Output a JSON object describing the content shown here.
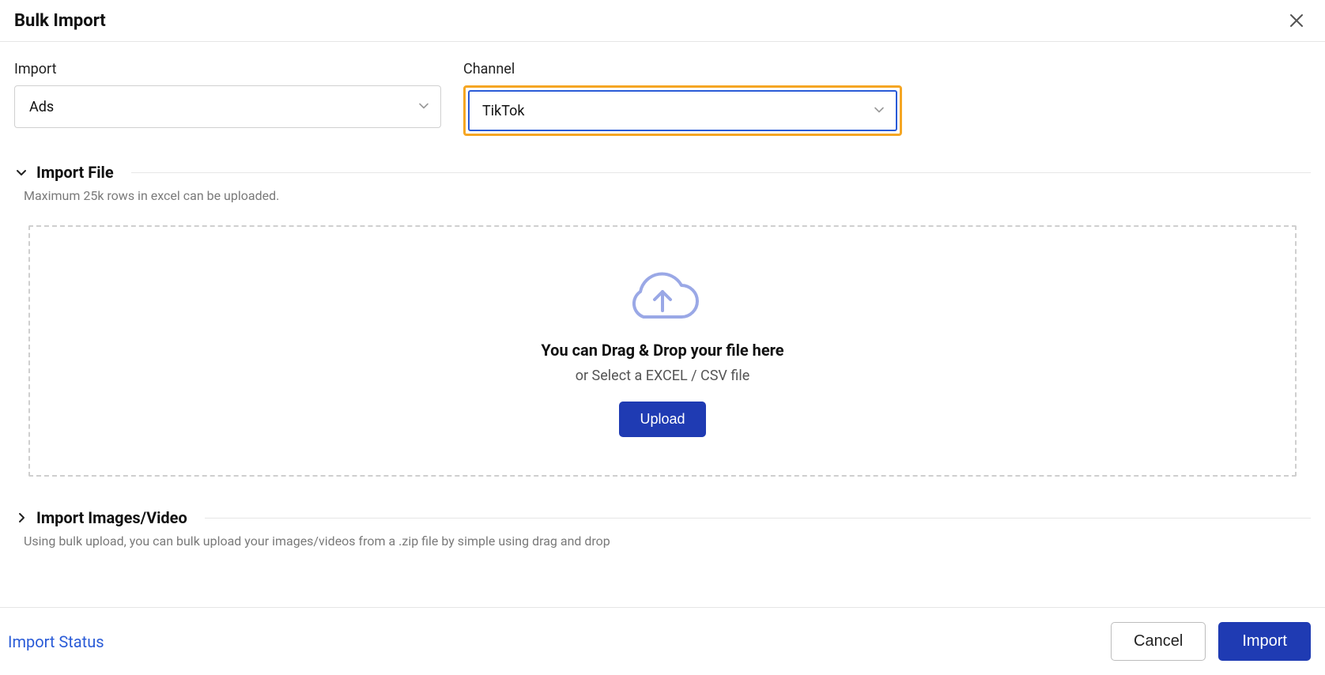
{
  "header": {
    "title": "Bulk Import"
  },
  "fields": {
    "import_label": "Import",
    "import_value": "Ads",
    "channel_label": "Channel",
    "channel_value": "TikTok"
  },
  "import_file": {
    "title": "Import File",
    "subtitle": "Maximum 25k rows in excel can be uploaded.",
    "drop_title": "You can Drag & Drop your file here",
    "drop_sub": "or Select a EXCEL / CSV file",
    "upload_label": "Upload"
  },
  "import_media": {
    "title": "Import Images/Video",
    "subtitle": "Using bulk upload, you can bulk upload your images/videos from a .zip file by simple using drag and drop"
  },
  "footer": {
    "status_link": "Import Status",
    "cancel_label": "Cancel",
    "import_label": "Import"
  }
}
